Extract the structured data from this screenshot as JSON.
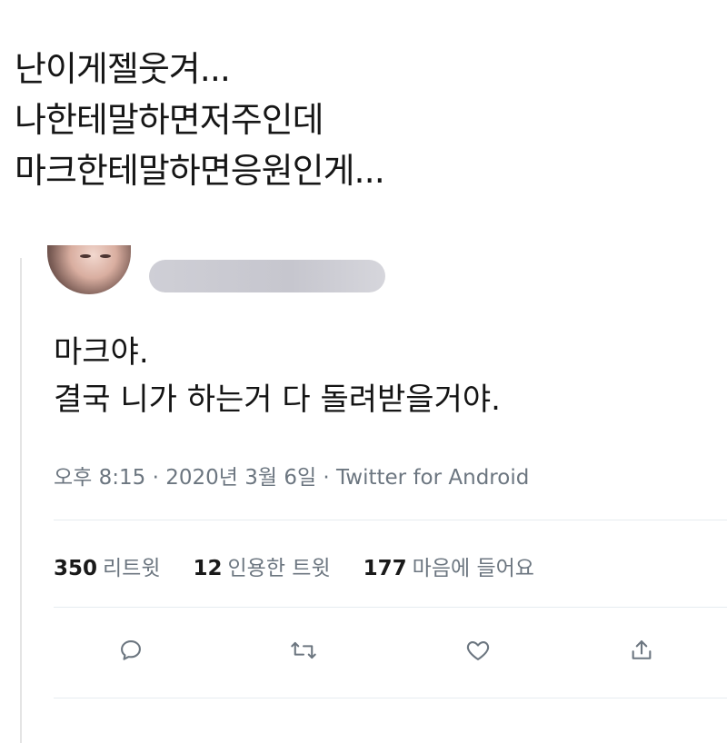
{
  "caption": {
    "lines": [
      "난이게젤웃겨...",
      "나한테말하면저주인데",
      "마크한테말하면응원인게..."
    ]
  },
  "tweet": {
    "text_lines": [
      "마크야.",
      "결국 니가 하는거 다 돌려받을거야."
    ],
    "meta": "오후 8:15 · 2020년 3월 6일 · Twitter for Android",
    "stats": {
      "retweets": {
        "num": "350",
        "label": "리트윗"
      },
      "quotes": {
        "num": "12",
        "label": "인용한 트윗"
      },
      "likes": {
        "num": "177",
        "label": "마음에 들어요"
      }
    },
    "actions": [
      "reply-icon",
      "retweet-icon",
      "like-icon",
      "share-icon"
    ]
  },
  "colors": {
    "icon": "#6c7680",
    "meta_text": "#6c7680",
    "divider": "#e6ecf0"
  }
}
